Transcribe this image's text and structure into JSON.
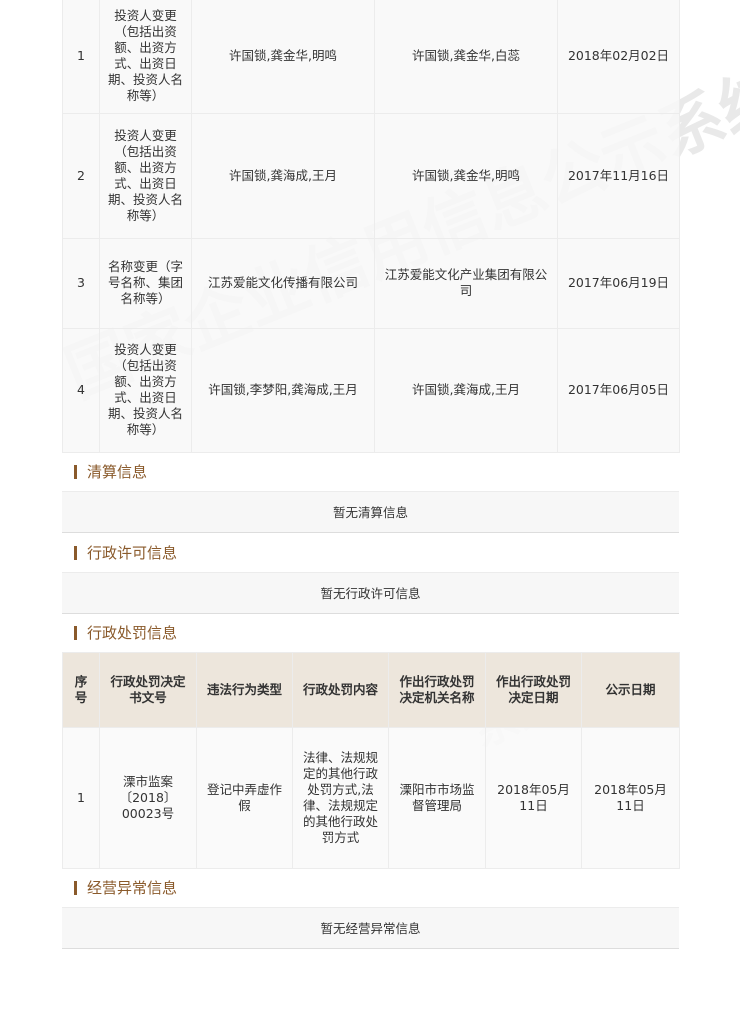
{
  "watermark": "国家企业信用信息公示系统",
  "changes": {
    "rows": [
      {
        "no": "1",
        "item": "投资人变更（包括出资额、出资方式、出资日期、投资人名称等）",
        "before": "许国锁,龚金华,明鸣",
        "after": "许国锁,龚金华,白蕊",
        "date": "2018年02月02日"
      },
      {
        "no": "2",
        "item": "投资人变更（包括出资额、出资方式、出资日期、投资人名称等）",
        "before": "许国锁,龚海成,王月",
        "after": "许国锁,龚金华,明鸣",
        "date": "2017年11月16日"
      },
      {
        "no": "3",
        "item": "名称变更（字号名称、集团名称等）",
        "before": "江苏爱能文化传播有限公司",
        "after": "江苏爱能文化产业集团有限公司",
        "date": "2017年06月19日"
      },
      {
        "no": "4",
        "item": "投资人变更（包括出资额、出资方式、出资日期、投资人名称等）",
        "before": "许国锁,李梦阳,龚海成,王月",
        "after": "许国锁,龚海成,王月",
        "date": "2017年06月05日"
      }
    ]
  },
  "liquidation": {
    "title": "清算信息",
    "empty": "暂无清算信息"
  },
  "admin_license": {
    "title": "行政许可信息",
    "empty": "暂无行政许可信息"
  },
  "admin_penalty": {
    "title": "行政处罚信息",
    "headers": [
      "序号",
      "行政处罚决定书文号",
      "违法行为类型",
      "行政处罚内容",
      "作出行政处罚决定机关名称",
      "作出行政处罚决定日期",
      "公示日期"
    ],
    "rows": [
      {
        "no": "1",
        "doc": "溧市监案〔2018〕00023号",
        "type": "登记中弄虚作假",
        "content": "法律、法规规定的其他行政处罚方式,法律、法规规定的其他行政处罚方式",
        "org": "溧阳市市场监督管理局",
        "decision_date": "2018年05月11日",
        "publish_date": "2018年05月11日"
      }
    ]
  },
  "abnormal": {
    "title": "经营异常信息",
    "empty": "暂无经营异常信息"
  }
}
